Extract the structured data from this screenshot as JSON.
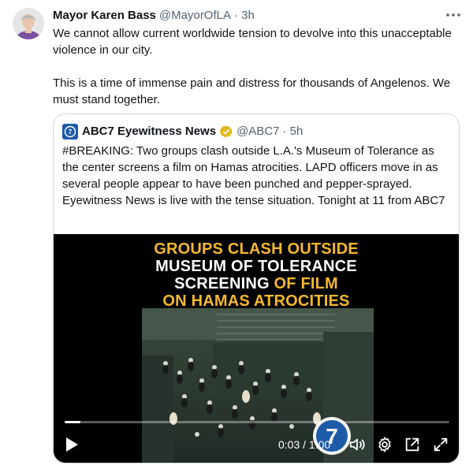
{
  "author": {
    "name": "Mayor Karen Bass",
    "handle": "@MayorOfLA",
    "time": "· 3h"
  },
  "tweet": {
    "paragraph1": "We cannot allow current worldwide tension to devolve into this unacceptable violence in our city.",
    "paragraph2": "This is a time of immense pain and distress for thousands of Angelenos. We must stand together."
  },
  "quote": {
    "name": "ABC7 Eyewitness News",
    "handle": "@ABC7",
    "time": "· 5h",
    "text": "#BREAKING: Two groups clash outside L.A.'s Museum of Tolerance as the center screens a film on Hamas atrocities. LAPD officers move in as several people appear to have been punched and pepper-sprayed. Eyewitness News is live with the tense situation. Tonight at 11 from ABC7"
  },
  "video": {
    "headline_line1": "GROUPS CLASH OUTSIDE",
    "headline_line2": "MUSEUM OF TOLERANCE",
    "headline_line3_white": "SCREENING ",
    "headline_line3_yellow": "OF FILM",
    "headline_line4": "ON HAMAS ATROCITIES",
    "time_display": "0:03 / 1:00",
    "progress": 0.04
  },
  "icons": {
    "more": "more-icon",
    "verified": "verified-badge-icon",
    "play": "play-icon",
    "volume": "volume-icon",
    "settings": "gear-icon",
    "pip": "picture-in-picture-icon",
    "fullscreen": "fullscreen-icon",
    "abc7_logo": "abc7-logo",
    "abc7_badge": "abc7-avatar-logo"
  },
  "colors": {
    "headline_yellow": "#f5b82e",
    "verified_gold": "#e2b719",
    "abc_blue": "#1d5aa8",
    "secondary_text": "#536471",
    "border": "#cfd9de"
  }
}
